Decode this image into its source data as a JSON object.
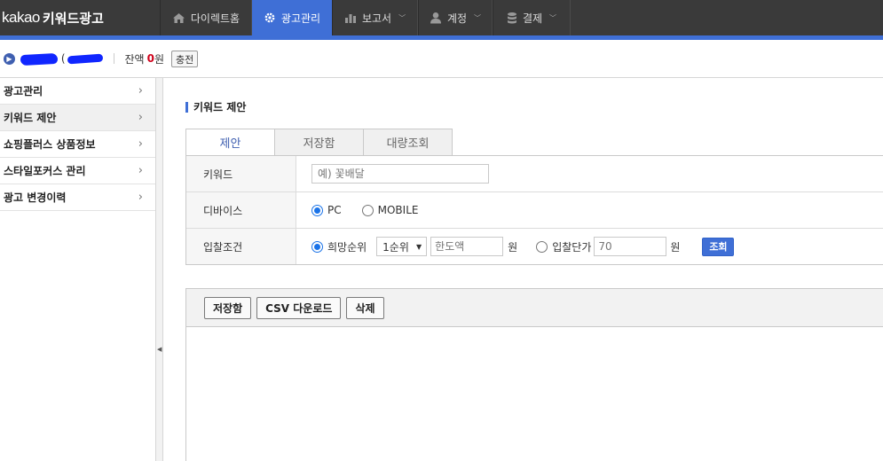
{
  "header": {
    "brand": "kakao",
    "product": "키워드광고",
    "nav": [
      {
        "label": "다이렉트홈",
        "icon": "home-icon",
        "dropdown": false
      },
      {
        "label": "광고관리",
        "icon": "gear-icon",
        "dropdown": false,
        "active": true
      },
      {
        "label": "보고서",
        "icon": "bar-chart-icon",
        "dropdown": true
      },
      {
        "label": "계정",
        "icon": "user-icon",
        "dropdown": true
      },
      {
        "label": "결제",
        "icon": "coins-icon",
        "dropdown": true
      }
    ]
  },
  "account": {
    "name_suffix": "(",
    "balance_label": "잔액",
    "balance_value": "0",
    "balance_unit": "원",
    "charge_label": "충전"
  },
  "sidebar": {
    "items": [
      {
        "label": "광고관리"
      },
      {
        "label": "키워드 제안",
        "active": true
      },
      {
        "label": "쇼핑플러스 상품정보"
      },
      {
        "label": "스타일포커스 관리"
      },
      {
        "label": "광고 변경이력"
      }
    ]
  },
  "main": {
    "section_title": "키워드 제안",
    "tabs": [
      {
        "label": "제안",
        "active": true
      },
      {
        "label": "저장함"
      },
      {
        "label": "대량조회"
      }
    ],
    "form": {
      "keyword_label": "키워드",
      "keyword_placeholder": "예) 꽃배달",
      "device_label": "디바이스",
      "device_options": [
        "PC",
        "MOBILE"
      ],
      "device_selected": "PC",
      "bid_label": "입찰조건",
      "bid_rank_option": "희망순위",
      "rank_value": "1순위",
      "limit_placeholder": "한도액",
      "unit": "원",
      "bid_price_option": "입찰단가",
      "bid_price_placeholder": "70",
      "query_button": "조회"
    },
    "toolbar": {
      "save_label": "저장함",
      "csv_label": "CSV 다운로드",
      "delete_label": "삭제"
    }
  },
  "colors": {
    "accent": "#3f6fd6",
    "topbar": "#3a3a3a",
    "balance": "#d0021b"
  }
}
